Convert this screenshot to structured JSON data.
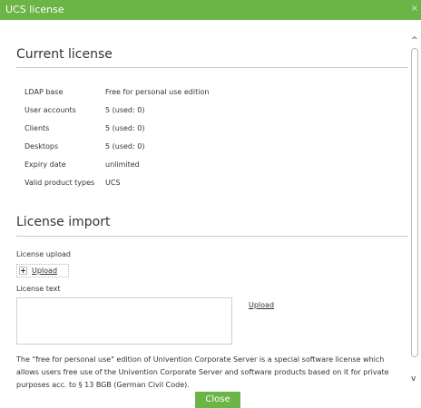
{
  "dialog": {
    "title": "UCS license",
    "close_glyph": "×"
  },
  "current_license": {
    "heading": "Current license",
    "rows": [
      {
        "key": "LDAP base",
        "value": "Free for personal use edition"
      },
      {
        "key": "User accounts",
        "value": "5 (used: 0)"
      },
      {
        "key": "Clients",
        "value": "5 (used: 0)"
      },
      {
        "key": "Desktops",
        "value": "5 (used: 0)"
      },
      {
        "key": "Expiry date",
        "value": "unlimited"
      },
      {
        "key": "Valid product types",
        "value": "UCS"
      }
    ]
  },
  "license_import": {
    "heading": "License import",
    "upload_label": "License upload",
    "upload_button": "Upload",
    "text_label": "License text",
    "text_value": "",
    "upload_link": "Upload"
  },
  "note": "The \"free for personal use\" edition of Univention Corporate Server is a special software license which allows users free use of the Univention Corporate Server and software products based on it for private purposes acc. to § 13 BGB (German Civil Code).",
  "scroll": {
    "up": "^",
    "down": "v"
  },
  "footer": {
    "close_label": "Close"
  },
  "colors": {
    "accent": "#6bb446"
  }
}
